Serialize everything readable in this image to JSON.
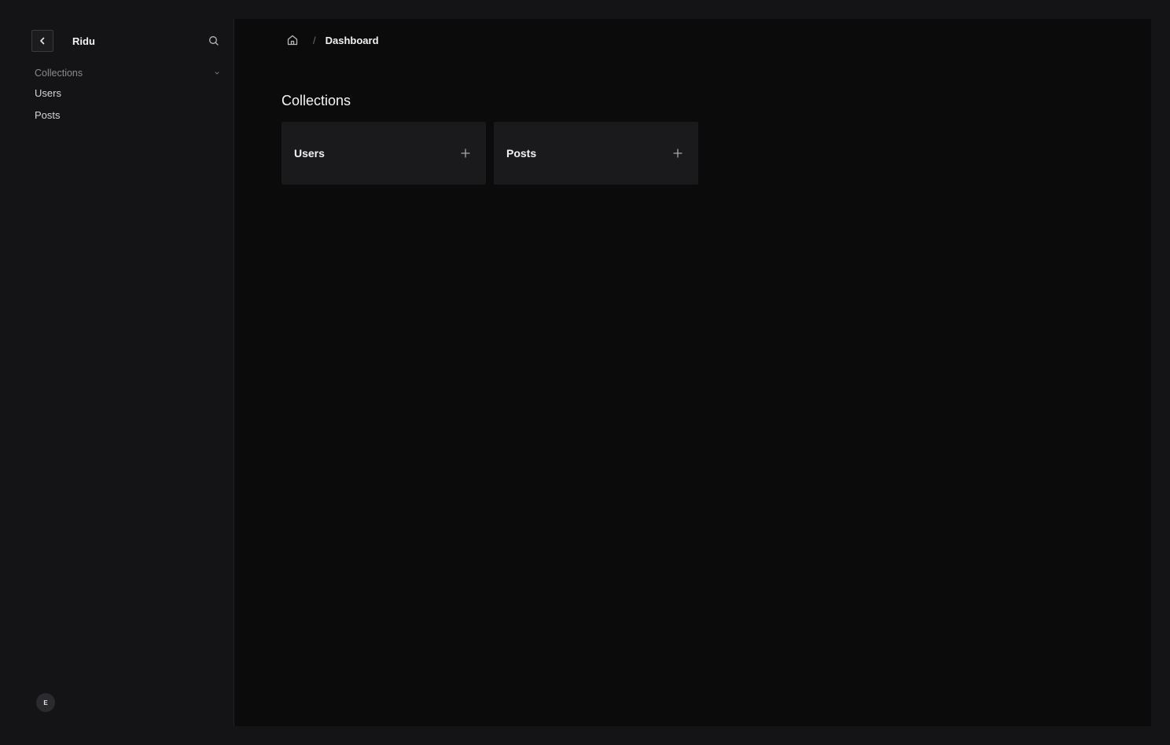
{
  "sidebar": {
    "app_name": "Ridu",
    "back_icon": "chevron-left-icon",
    "search_icon": "search-icon",
    "group": {
      "label": "Collections",
      "icon": "chevron-down-icon"
    },
    "items": [
      {
        "label": "Users"
      },
      {
        "label": "Posts"
      }
    ],
    "avatar_initial": "E"
  },
  "breadcrumb": {
    "home_icon": "home-icon",
    "separator": "/",
    "current": "Dashboard"
  },
  "main": {
    "title": "Collections",
    "cards": [
      {
        "label": "Users",
        "icon": "plus-icon"
      },
      {
        "label": "Posts",
        "icon": "plus-icon"
      }
    ]
  },
  "colors": {
    "background": "#0b0b0c",
    "sidebar": "#141416",
    "card": "#1a1a1c",
    "text": "#f2f2f2",
    "muted": "#8a8a8f"
  }
}
